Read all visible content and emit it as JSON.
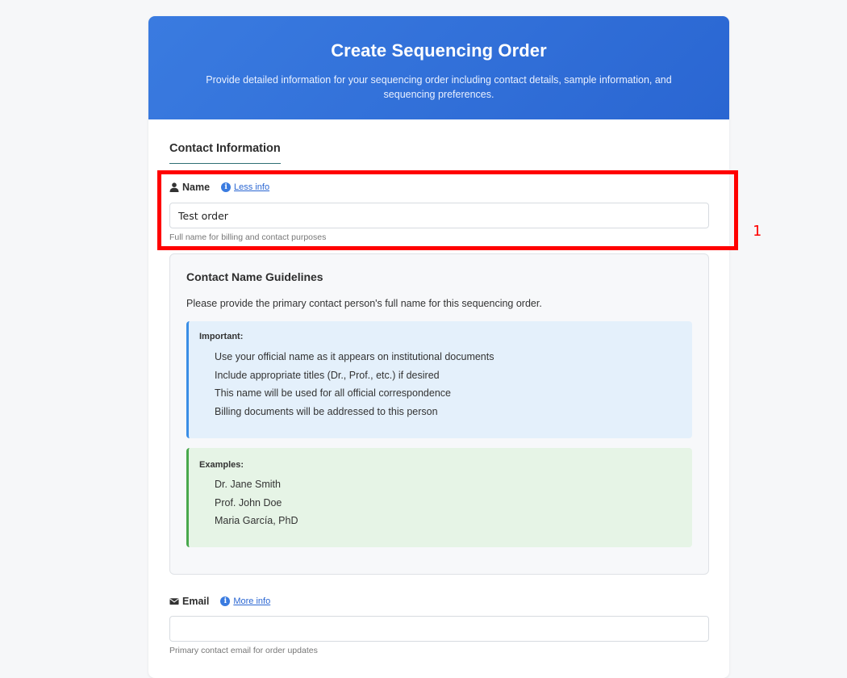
{
  "header": {
    "title": "Create Sequencing Order",
    "subtitle": "Provide detailed information for your sequencing order including contact details, sample information, and sequencing preferences."
  },
  "section": {
    "title": "Contact Information"
  },
  "name_field": {
    "label": "Name",
    "icon": "user-icon",
    "info_link": "Less info",
    "value": "Test order",
    "hint": "Full name for billing and contact purposes"
  },
  "guidelines": {
    "title": "Contact Name Guidelines",
    "intro": "Please provide the primary contact person's full name for this sequencing order.",
    "important": {
      "title": "Important:",
      "items": [
        "Use your official name as it appears on institutional documents",
        "Include appropriate titles (Dr., Prof., etc.) if desired",
        "This name will be used for all official correspondence",
        "Billing documents will be addressed to this person"
      ],
      "accent": "#3a8ee6"
    },
    "examples": {
      "title": "Examples:",
      "items": [
        "Dr. Jane Smith",
        "Prof. John Doe",
        "Maria García, PhD"
      ],
      "accent": "#48a84c"
    }
  },
  "email_field": {
    "label": "Email",
    "icon": "envelope-icon",
    "info_link": "More info",
    "value": "",
    "hint": "Primary contact email for order updates"
  },
  "annotation": {
    "number": "1",
    "color": "#ff0000"
  },
  "colors": {
    "header_bg": "#2a66d2",
    "link": "#2a66d2"
  }
}
